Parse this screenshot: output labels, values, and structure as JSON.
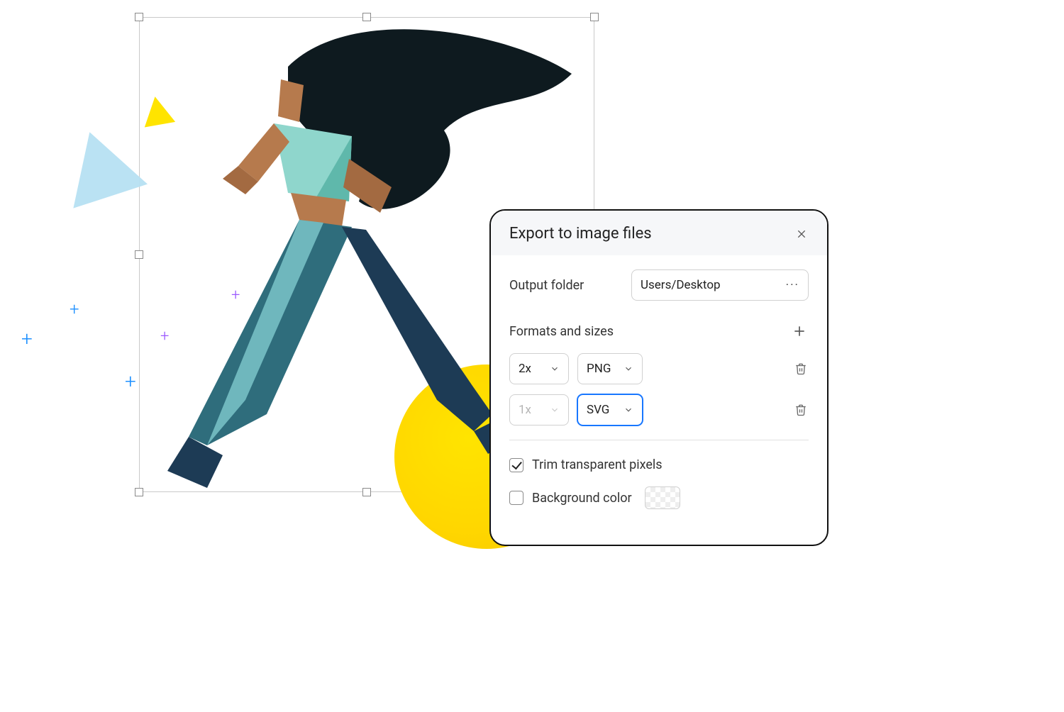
{
  "panel": {
    "title": "Export to image files",
    "output_folder_label": "Output folder",
    "output_folder_value": "Users/Desktop",
    "formats_label": "Formats and sizes",
    "rows": [
      {
        "size": "2x",
        "format": "PNG",
        "size_disabled": false,
        "focused": false
      },
      {
        "size": "1x",
        "format": "SVG",
        "size_disabled": true,
        "focused": true
      }
    ],
    "trim_label": "Trim transparent pixels",
    "trim_checked": true,
    "bg_label": "Background color",
    "bg_checked": false
  }
}
